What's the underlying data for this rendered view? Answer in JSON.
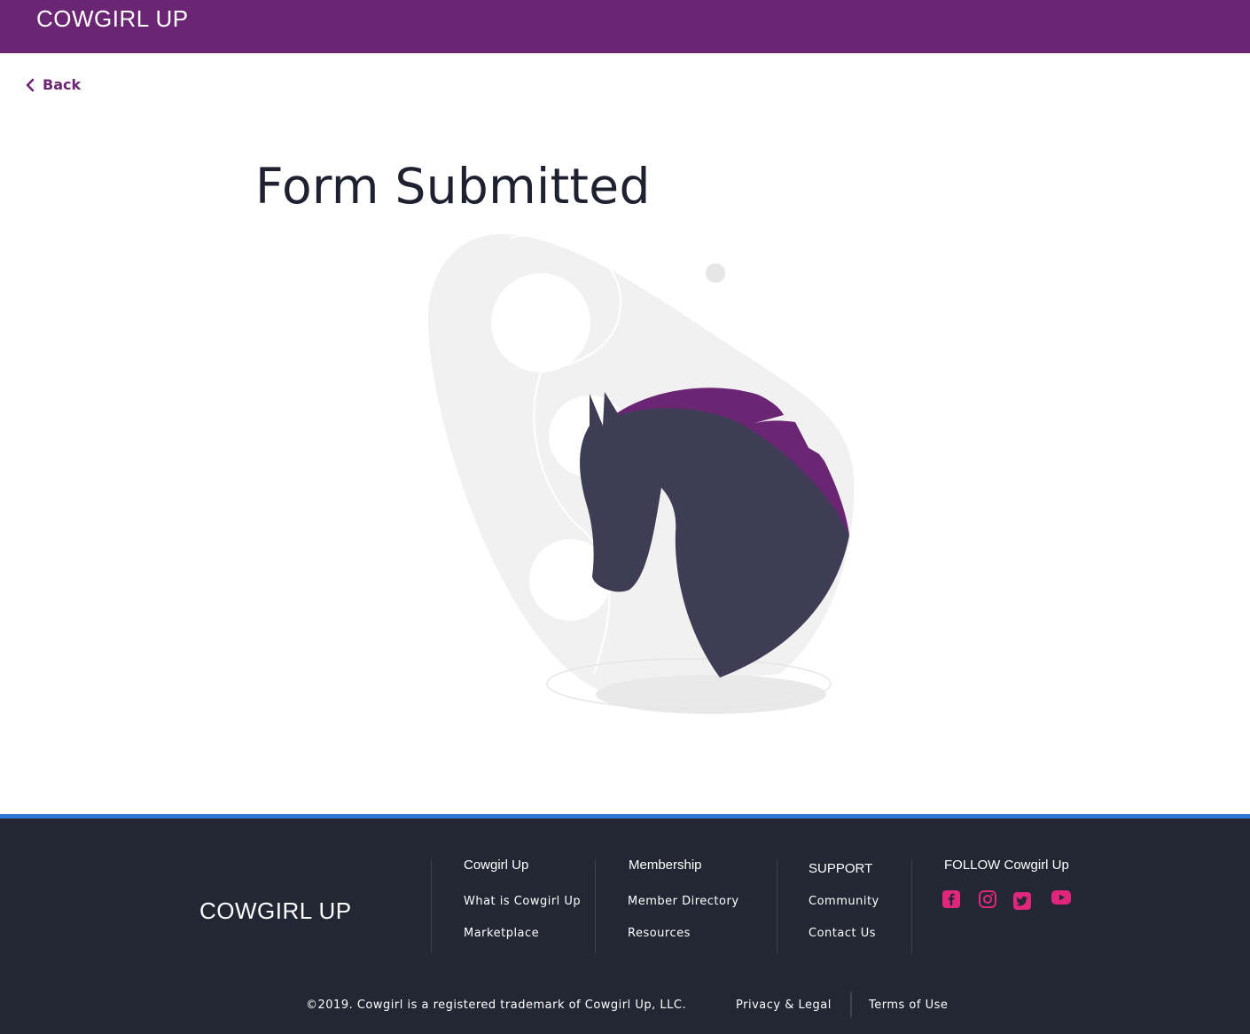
{
  "header": {
    "brand": "COWGIRL UP"
  },
  "nav": {
    "back_label": "Back"
  },
  "main": {
    "title": "Form Submitted"
  },
  "footer": {
    "brand": "COWGIRL UP",
    "columns": [
      {
        "heading": "Cowgirl Up",
        "links": [
          "What is Cowgirl Up",
          "Marketplace"
        ]
      },
      {
        "heading": "Membership",
        "links": [
          "Member Directory",
          "Resources"
        ]
      },
      {
        "heading": "SUPPORT",
        "links": [
          "Community",
          "Contact Us"
        ]
      }
    ],
    "follow_heading": "FOLLOW Cowgirl Up",
    "social": [
      "facebook-icon",
      "instagram-icon",
      "twitter-icon",
      "youtube-icon"
    ],
    "copyright": "©2019. Cowgirl is a registered trademark of Cowgirl Up, LLC.",
    "legal_links": [
      "Privacy & Legal",
      "Terms of Use"
    ]
  },
  "colors": {
    "brand_purple": "#6b2673",
    "footer_bg": "#222733",
    "footer_accent": "#2f77d6",
    "social_pink": "#e0277d",
    "horse": "#3f3d56"
  }
}
